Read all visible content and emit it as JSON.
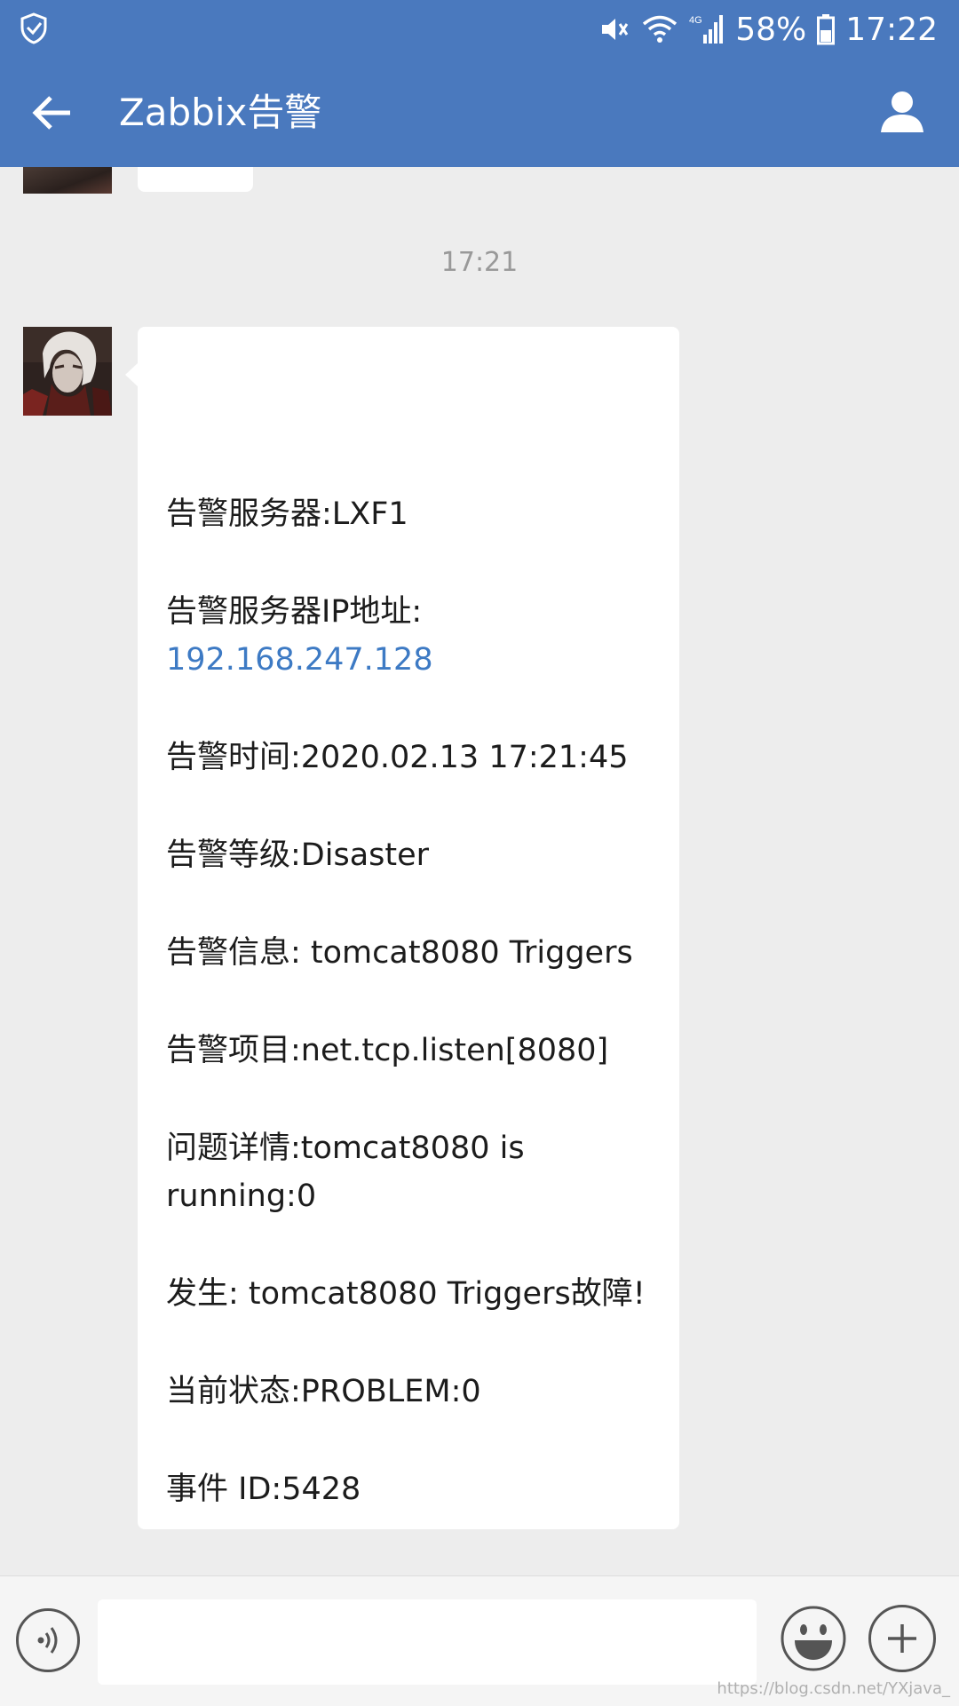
{
  "status_bar": {
    "battery": "58%",
    "time": "17:22",
    "network": "4G",
    "icons": [
      "shield-icon",
      "mute-icon",
      "wifi-icon",
      "signal-icon",
      "battery-icon"
    ]
  },
  "header": {
    "title": "Zabbix告警",
    "icons": [
      "back-arrow-icon",
      "profile-icon"
    ],
    "color": "#4a79be"
  },
  "chat": {
    "timestamp": "17:21",
    "message": {
      "server": "告警服务器:LXF1",
      "ip_label": "告警服务器IP地址:",
      "ip_value": "192.168.247.128",
      "time": "告警时间:2020.02.13 17:21:45",
      "level": "告警等级:Disaster",
      "info": "告警信息: tomcat8080 Triggers",
      "item": "告警项目:net.tcp.listen[8080]",
      "detail_line1": "问题详情:tomcat8080 is",
      "detail_line2": "running:0",
      "occurred": "发生: tomcat8080 Triggers故障!",
      "status": "当前状态:PROBLEM:0",
      "event_id": "事件 ID:5428"
    },
    "link_color": "#3d7ac4"
  },
  "input_bar": {
    "icons": [
      "voice-icon",
      "emoji-icon",
      "plus-icon"
    ],
    "placeholder": ""
  },
  "watermark": "https://blog.csdn.net/YXjava_"
}
